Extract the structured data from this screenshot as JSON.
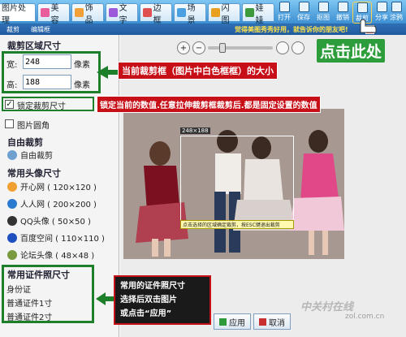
{
  "tabs": [
    {
      "label": "图片处理",
      "color": "#2f78c4"
    },
    {
      "label": "美容",
      "color": "#e85d9a"
    },
    {
      "label": "饰品",
      "color": "#f2a13a"
    },
    {
      "label": "文字",
      "color": "#9b5ad9"
    },
    {
      "label": "边框",
      "color": "#e05050"
    },
    {
      "label": "场景",
      "color": "#4aa0e0"
    },
    {
      "label": "闪图",
      "color": "#e8a020"
    },
    {
      "label": "娃娃",
      "color": "#3c9a3c"
    }
  ],
  "toolbar": [
    "打开",
    "保存",
    "抠图",
    "撤销",
    "裁剪",
    "分享",
    "涂鸦"
  ],
  "bar2": {
    "crop_label": "裁剪",
    "editor_label": "编辑框",
    "promo": "觉得美图秀秀好用，就告诉你的朋友吧!",
    "close": "×"
  },
  "left_panel": {
    "crop_size_title": "裁剪区域尺寸",
    "width_label": "宽:",
    "width_value": "248",
    "height_label": "高:",
    "height_value": "188",
    "unit": "像素",
    "lock_label": "锁定裁剪尺寸",
    "rounded_label": "图片圆角",
    "free_crop_title": "自由裁剪",
    "free_crop_item": "自由裁剪",
    "avatar_title": "常用头像尺寸",
    "avatar_items": [
      {
        "label": "开心网 ( 120×120 )",
        "color": "#f0a030"
      },
      {
        "label": "人人网 ( 200×200 )",
        "color": "#2a7bd0"
      },
      {
        "label": "QQ头像 ( 50×50 )",
        "color": "#333333"
      },
      {
        "label": "百度空间 ( 110×110 )",
        "color": "#2050c0"
      },
      {
        "label": "论坛头像 ( 48×48 )",
        "color": "#7a9a40"
      }
    ],
    "id_title": "常用证件照尺寸",
    "id_items": [
      "身份证",
      "普通证件1寸",
      "普通证件2寸"
    ]
  },
  "workspace": {
    "zoom_in": "+",
    "zoom_out": "−",
    "crop_size_tag": "248×188",
    "hint": "点击选择的区域确定裁剪，按ESC键退出裁剪",
    "apply_button": "应用",
    "cancel_button": "取消"
  },
  "annotations": {
    "crop_box_note": "当前裁剪框（图片中白色框框）的大小",
    "lock_note": "锁定当前的数值.任意拉伸裁剪框裁剪后.都是固定设置的数值",
    "click_here": "点击此处",
    "id_note_line1": "常用的证件照尺寸",
    "id_note_line2": "选择后双击图片",
    "id_note_line3": "或点击“应用”"
  },
  "watermark": "中关村在线",
  "watermark_url": "zol.com.cn"
}
